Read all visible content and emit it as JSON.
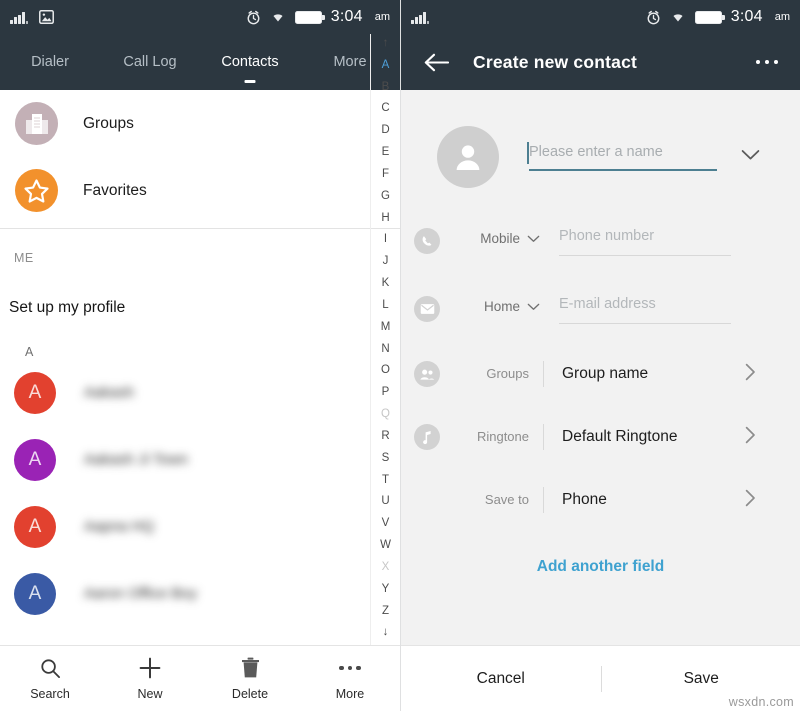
{
  "status_bar": {
    "time": "3:04",
    "ampm": "am",
    "icons_left": [
      "signal-icon",
      "gallery-icon"
    ],
    "icons_right": [
      "alarm-icon",
      "wifi-icon",
      "battery-icon"
    ]
  },
  "status_bar_right_pane": {
    "time": "3:04",
    "ampm": "am",
    "icons_left": [
      "signal-icon"
    ],
    "icons_right": [
      "alarm-icon",
      "wifi-icon",
      "battery-icon"
    ]
  },
  "left_pane": {
    "tabs": [
      {
        "label": "Dialer",
        "active": false
      },
      {
        "label": "Call Log",
        "active": false
      },
      {
        "label": "Contacts",
        "active": true
      },
      {
        "label": "More",
        "active": false
      }
    ],
    "shortcuts": [
      {
        "label": "Groups",
        "icon": "building-icon",
        "color": "#c3b0b6"
      },
      {
        "label": "Favorites",
        "icon": "star-icon",
        "color": "#f2912c"
      }
    ],
    "me_section_header": "ME",
    "profile_row": "Set up my profile",
    "alpha_section_header": "A",
    "contacts": [
      {
        "initial": "A",
        "name": "Aakash",
        "color": "#e2412f"
      },
      {
        "initial": "A",
        "name": "Aakash Ji Town",
        "color": "#9a23b5"
      },
      {
        "initial": "A",
        "name": "Aapna HQ",
        "color": "#e2412f"
      },
      {
        "initial": "A",
        "name": "Aaron Office Boy",
        "color": "#3a5aa5"
      }
    ],
    "alpha_index": [
      {
        "label": "↑",
        "state": "normal"
      },
      {
        "label": "A",
        "state": "active"
      },
      {
        "label": "B",
        "state": "normal"
      },
      {
        "label": "C",
        "state": "normal"
      },
      {
        "label": "D",
        "state": "normal"
      },
      {
        "label": "E",
        "state": "normal"
      },
      {
        "label": "F",
        "state": "normal"
      },
      {
        "label": "G",
        "state": "normal"
      },
      {
        "label": "H",
        "state": "normal"
      },
      {
        "label": "I",
        "state": "normal"
      },
      {
        "label": "J",
        "state": "normal"
      },
      {
        "label": "K",
        "state": "normal"
      },
      {
        "label": "L",
        "state": "normal"
      },
      {
        "label": "M",
        "state": "normal"
      },
      {
        "label": "N",
        "state": "normal"
      },
      {
        "label": "O",
        "state": "normal"
      },
      {
        "label": "P",
        "state": "normal"
      },
      {
        "label": "Q",
        "state": "dim"
      },
      {
        "label": "R",
        "state": "normal"
      },
      {
        "label": "S",
        "state": "normal"
      },
      {
        "label": "T",
        "state": "normal"
      },
      {
        "label": "U",
        "state": "normal"
      },
      {
        "label": "V",
        "state": "normal"
      },
      {
        "label": "W",
        "state": "normal"
      },
      {
        "label": "X",
        "state": "dim"
      },
      {
        "label": "Y",
        "state": "normal"
      },
      {
        "label": "Z",
        "state": "normal"
      },
      {
        "label": "↓",
        "state": "normal"
      }
    ],
    "bottom_bar": [
      {
        "label": "Search",
        "icon": "search-icon"
      },
      {
        "label": "New",
        "icon": "plus-icon"
      },
      {
        "label": "Delete",
        "icon": "trash-icon"
      },
      {
        "label": "More",
        "icon": "more-dots-icon"
      }
    ]
  },
  "right_pane": {
    "title": "Create new contact",
    "back_icon": "back-arrow-icon",
    "more_icon": "more-dots-icon",
    "name_field": {
      "placeholder": "Please enter a name",
      "value": "",
      "avatar_icon": "person-icon",
      "expand_icon": "chevron-down-icon"
    },
    "fields": [
      {
        "icon": "phone-icon",
        "type_label": "Mobile",
        "type_icon": "chevron-down-icon",
        "placeholder": "Phone number",
        "value": ""
      },
      {
        "icon": "mail-icon",
        "type_label": "Home",
        "type_icon": "chevron-down-icon",
        "placeholder": "E-mail address",
        "value": ""
      }
    ],
    "pickers": [
      {
        "icon": "group-people-icon",
        "label": "Groups",
        "value": "Group name",
        "chevron": "chevron-right-icon"
      },
      {
        "icon": "music-note-icon",
        "label": "Ringtone",
        "value": "Default Ringtone",
        "chevron": "chevron-right-icon"
      },
      {
        "icon": "",
        "label": "Save to",
        "value": "Phone",
        "chevron": "chevron-right-icon"
      }
    ],
    "add_field_label": "Add another field",
    "bottom_bar": {
      "cancel_label": "Cancel",
      "save_label": "Save"
    }
  },
  "watermark": "wsxdn.com",
  "colors": {
    "header_bg": "#2c3740",
    "accent_link": "#3fa2d0",
    "name_underline": "#4d7f91",
    "index_active": "#4e9fd8",
    "favorites_orange": "#f2912c"
  }
}
